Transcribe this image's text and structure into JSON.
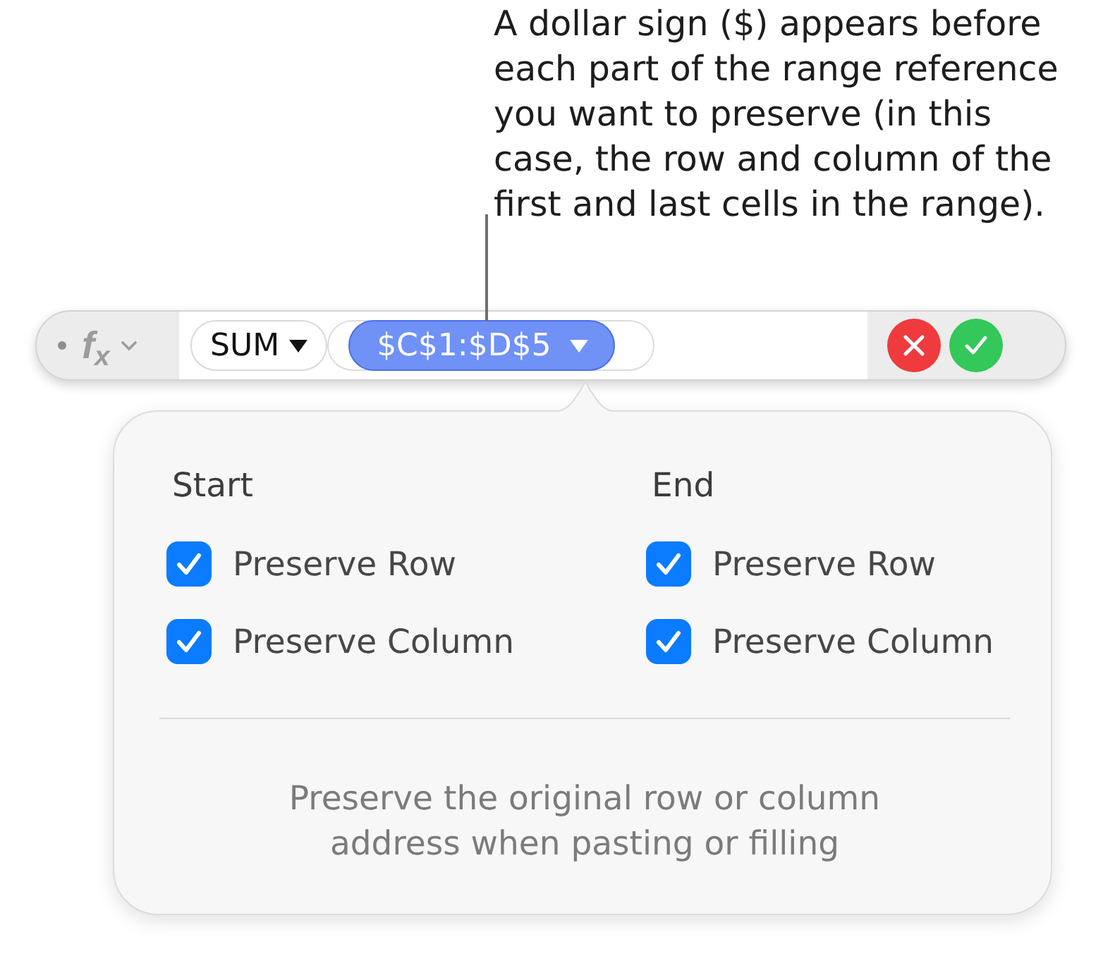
{
  "callout": {
    "lines": [
      "A dollar sign ($) appears before",
      "each part of the range reference",
      "you want to preserve (in this",
      "case, the row and column of the",
      "first and last cells in the range)."
    ]
  },
  "formula_bar": {
    "function_label": "f$_{x}$",
    "function": {
      "text": "SUM",
      "selected": false
    },
    "arguments": [
      {
        "text": "$C$1:$D$5",
        "selected": true
      }
    ]
  },
  "popover": {
    "columns": [
      {
        "heading": "Start",
        "options": [
          {
            "label": "Preserve Row",
            "checked": true
          },
          {
            "label": "Preserve Column",
            "checked": true
          }
        ]
      },
      {
        "heading": "End",
        "options": [
          {
            "label": "Preserve Row",
            "checked": true
          },
          {
            "label": "Preserve Column",
            "checked": true
          }
        ]
      }
    ],
    "note": {
      "lines": [
        "Preserve the original row or column",
        "address when pasting or filling"
      ]
    }
  }
}
